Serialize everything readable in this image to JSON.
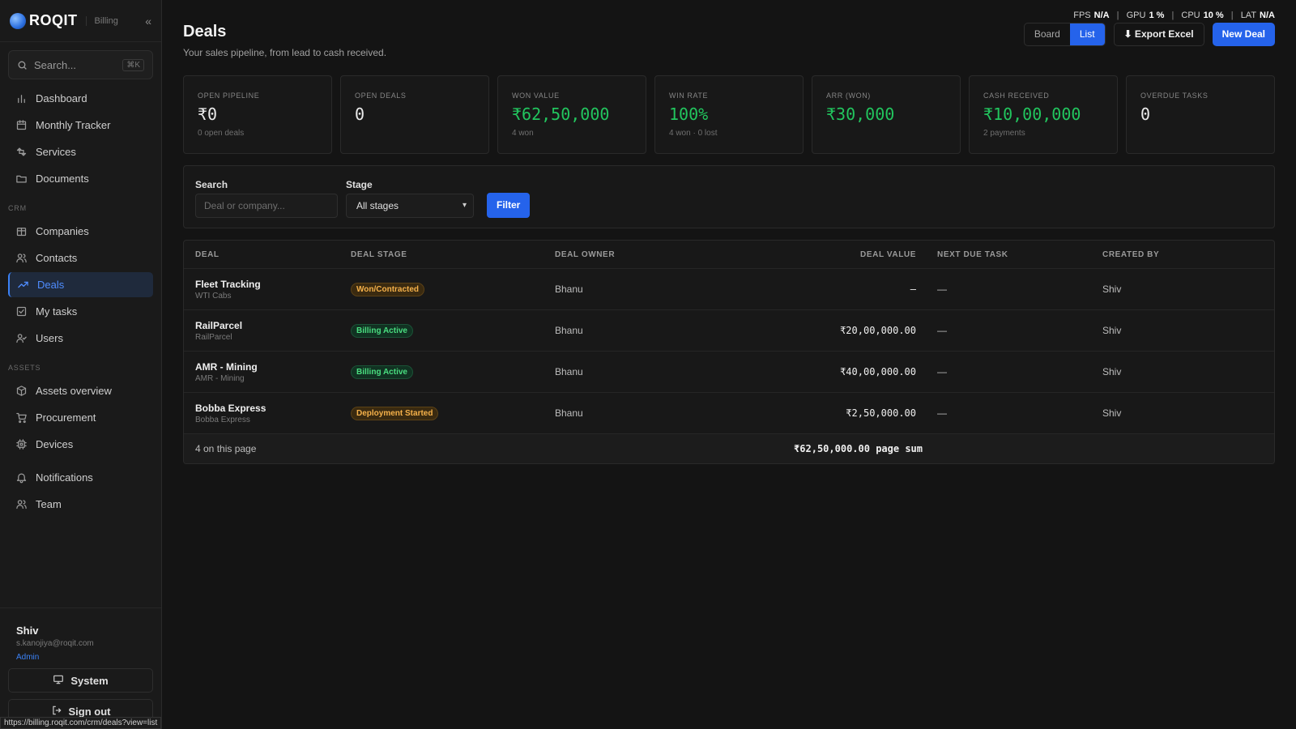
{
  "brand": {
    "name": "ROQIT",
    "sub": "Billing"
  },
  "sidebar": {
    "search_placeholder": "Search...",
    "search_kbd": "⌘K",
    "items_main": [
      {
        "label": "Dashboard",
        "icon": "bar-chart-icon"
      },
      {
        "label": "Monthly Tracker",
        "icon": "calendar-icon"
      },
      {
        "label": "Services",
        "icon": "refresh-icon"
      },
      {
        "label": "Documents",
        "icon": "folder-icon"
      }
    ],
    "crm_heading": "CRM",
    "items_crm": [
      {
        "label": "Companies",
        "icon": "building-icon"
      },
      {
        "label": "Contacts",
        "icon": "users-icon"
      },
      {
        "label": "Deals",
        "icon": "trending-up-icon",
        "active": true
      },
      {
        "label": "My tasks",
        "icon": "checkbox-icon"
      },
      {
        "label": "Users",
        "icon": "user-check-icon"
      }
    ],
    "assets_heading": "ASSETS",
    "items_assets": [
      {
        "label": "Assets overview",
        "icon": "box-icon"
      },
      {
        "label": "Procurement",
        "icon": "cart-icon"
      },
      {
        "label": "Devices",
        "icon": "chip-icon"
      }
    ],
    "items_extra": [
      {
        "label": "Notifications",
        "icon": "bell-icon"
      },
      {
        "label": "Team",
        "icon": "users-icon"
      }
    ],
    "user": {
      "name": "Shiv",
      "email": "s.kanojiya@roqit.com",
      "role": "Admin"
    },
    "system_label": "System",
    "signout_label": "Sign out"
  },
  "status_url": "https://billing.roqit.com/crm/deals?view=list",
  "perf": {
    "fps_label": "FPS",
    "fps": "N/A",
    "gpu_label": "GPU",
    "gpu": "1 %",
    "cpu_label": "CPU",
    "cpu": "10 %",
    "lat_label": "LAT",
    "lat": "N/A"
  },
  "header": {
    "title": "Deals",
    "subtitle": "Your sales pipeline, from lead to cash received.",
    "view_board": "Board",
    "view_list": "List",
    "export_label": "⬇ Export Excel",
    "new_label": "New Deal"
  },
  "stats": [
    {
      "label": "OPEN PIPELINE",
      "value": "₹0",
      "note": "0 open deals",
      "green": false
    },
    {
      "label": "OPEN DEALS",
      "value": "0",
      "note": "",
      "green": false
    },
    {
      "label": "WON VALUE",
      "value": "₹62,50,000",
      "note": "4 won",
      "green": true
    },
    {
      "label": "WIN RATE",
      "value": "100%",
      "note": "4 won · 0 lost",
      "green": true
    },
    {
      "label": "ARR (WON)",
      "value": "₹30,000",
      "note": "",
      "green": true
    },
    {
      "label": "CASH RECEIVED",
      "value": "₹10,00,000",
      "note": "2 payments",
      "green": true
    },
    {
      "label": "OVERDUE TASKS",
      "value": "0",
      "note": "",
      "green": false
    }
  ],
  "filter": {
    "search_label": "Search",
    "search_placeholder": "Deal or company...",
    "stage_label": "Stage",
    "stage_value": "All stages",
    "button": "Filter"
  },
  "table": {
    "columns": [
      "DEAL",
      "DEAL STAGE",
      "DEAL OWNER",
      "DEAL VALUE",
      "NEXT DUE TASK",
      "CREATED BY"
    ],
    "rows": [
      {
        "deal": "Fleet Tracking",
        "company": "WTI Cabs",
        "stage": "Won/Contracted",
        "stage_color": "amber",
        "owner": "Bhanu",
        "value": "–",
        "task": "—",
        "created_by": "Shiv"
      },
      {
        "deal": "RailParcel",
        "company": "RailParcel",
        "stage": "Billing Active",
        "stage_color": "green",
        "owner": "Bhanu",
        "value": "₹20,00,000.00",
        "task": "—",
        "created_by": "Shiv"
      },
      {
        "deal": "AMR - Mining",
        "company": "AMR - Mining",
        "stage": "Billing Active",
        "stage_color": "green",
        "owner": "Bhanu",
        "value": "₹40,00,000.00",
        "task": "—",
        "created_by": "Shiv"
      },
      {
        "deal": "Bobba Express",
        "company": "Bobba Express",
        "stage": "Deployment Started",
        "stage_color": "amber",
        "owner": "Bhanu",
        "value": "₹2,50,000.00",
        "task": "—",
        "created_by": "Shiv"
      }
    ],
    "footer_count": "4 on this page",
    "footer_sum": "₹62,50,000.00 page sum"
  }
}
